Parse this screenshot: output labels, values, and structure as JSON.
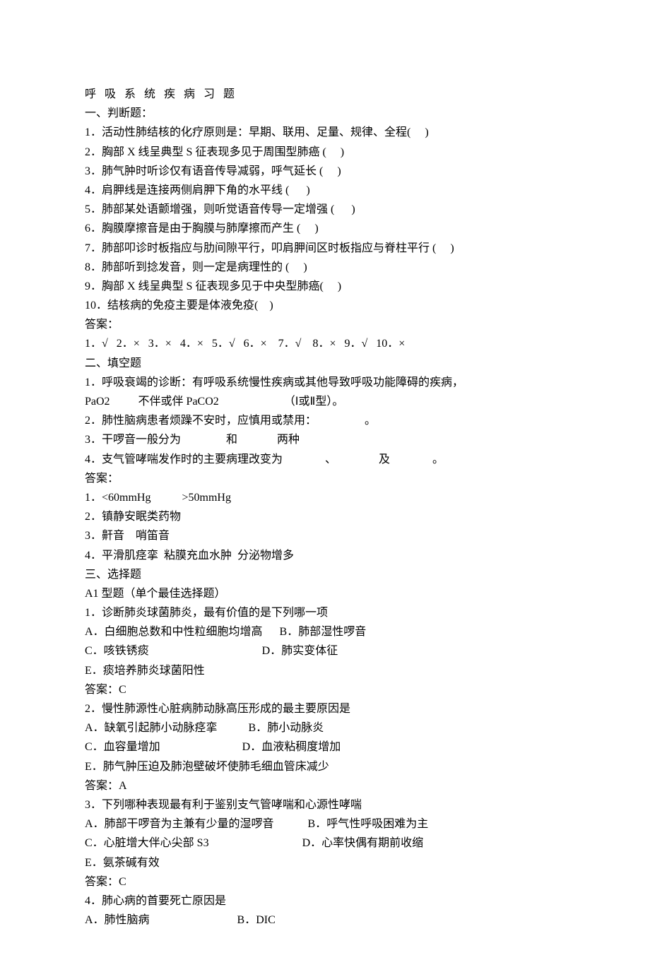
{
  "title": "呼 吸 系 统 疾 病 习 题",
  "sections": {
    "s1": {
      "header": "一、判断题：",
      "items": [
        "1．活动性肺结核的化疗原则是：早期、联用、足量、规律、全程(     )",
        "2．胸部 X 线呈典型 S 征表现多见于周围型肺癌 (     )",
        "3．肺气肿时听诊仅有语音传导减弱，呼气延长 (     )",
        "4．肩胛线是连接两侧肩胛下角的水平线 (      )",
        "5．肺部某处语颤增强，则听觉语音传导一定增强 (      )",
        "6．胸膜摩擦音是由于胸膜与肺摩擦而产生 (     )",
        "7．肺部叩诊时板指应与肋间隙平行，叩肩胛间区时板指应与脊柱平行 (     )",
        "8．肺部听到捻发音，则一定是病理性的 (     )",
        "9．胸部 X 线呈典型 S 征表现多见于中央型肺癌(     )",
        "10．结核病的免疫主要是体液免疫(    )"
      ],
      "ans_label": "答案：",
      "ans": "1．√   2．×   3．×   4．×   5．√   6．×    7．√    8．×   9．√   10．×"
    },
    "s2": {
      "header": "二、填空题",
      "items": [
        "1．呼吸衰竭的诊断：有呼吸系统慢性疾病或其他导致呼吸功能障碍的疾病，",
        "PaO2          不伴或伴 PaCO2                       （Ⅰ或Ⅱ型）。",
        "2．肺性脑病患者烦躁不安时，应慎用或禁用：                 。",
        "3．干啰音一般分为                和              两种",
        "4．支气管哮喘发作时的主要病理改变为               、               及               。"
      ],
      "ans_label": "答案：",
      "answers": [
        "1．<60mmHg           >50mmHg",
        "2．镇静安眠类药物",
        "3．鼾音    哨笛音",
        "4．平滑肌痉挛  粘膜充血水肿  分泌物增多"
      ]
    },
    "s3": {
      "header": "三、选择题",
      "subheader": "A1 型题（单个最佳选择题）",
      "q1": {
        "stem": "1．诊断肺炎球菌肺炎，最有价值的是下列哪一项",
        "row1": "A．白细胞总数和中性粒细胞均增高      B．肺部湿性啰音",
        "row2": "C．咳铁锈痰                                        D．肺实变体征",
        "row3": "E．痰培养肺炎球菌阳性",
        "ans": "答案：C"
      },
      "q2": {
        "stem": "2．慢性肺源性心脏病肺动脉高压形成的最主要原因是",
        "row1": "A．缺氧引起肺小动脉痉挛           B．肺小动脉炎",
        "row2": "C．血容量增加                             D．血液粘稠度增加",
        "row3": "E．肺气肿压迫及肺泡壁破坏使肺毛细血管床减少",
        "ans": "答案：A"
      },
      "q3": {
        "stem": "3．下列哪种表现最有利于鉴别支气管哮喘和心源性哮喘",
        "row1": "A．肺部干啰音为主兼有少量的湿啰音            B．呼气性呼吸困难为主",
        "row2": "C．心脏增大伴心尖部 S3                                 D．心率快偶有期前收缩",
        "row3": "E．氨茶碱有效",
        "ans": "答案：C"
      },
      "q4": {
        "stem": "4．肺心病的首要死亡原因是",
        "row1": "A．肺性脑病                               B．DIC"
      }
    }
  }
}
